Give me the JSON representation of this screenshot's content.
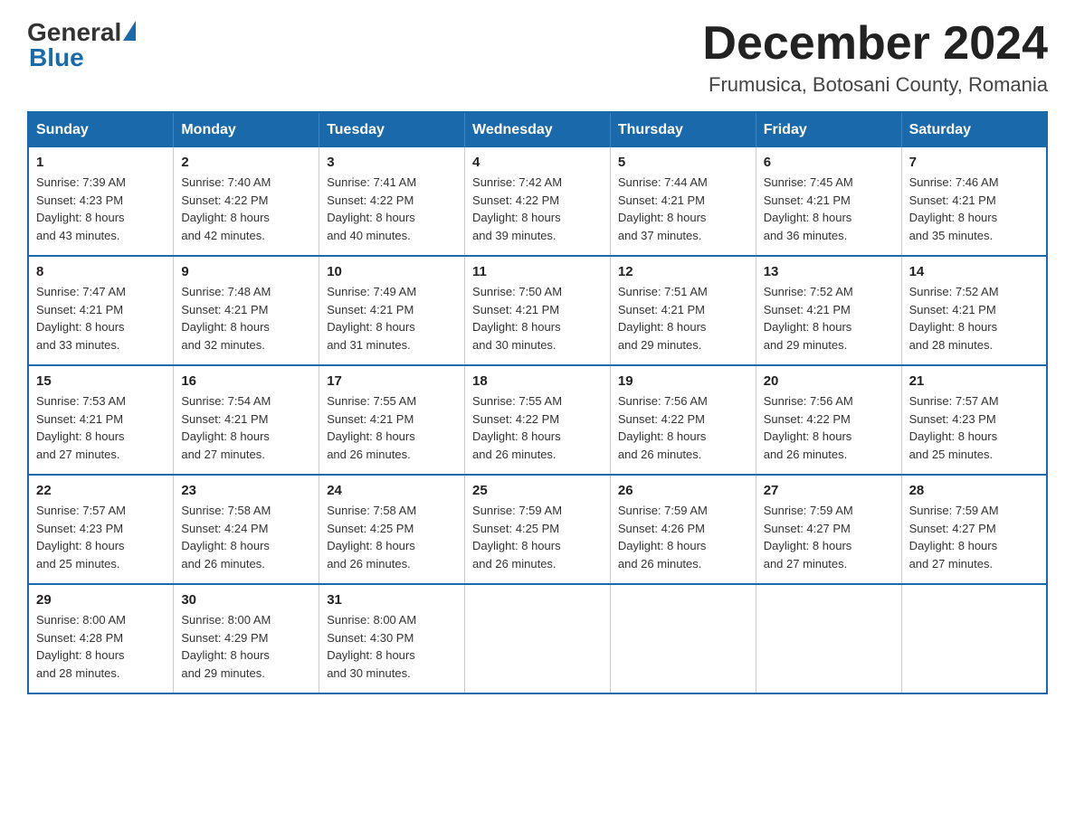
{
  "header": {
    "logo_general": "General",
    "logo_blue": "Blue",
    "month_title": "December 2024",
    "location": "Frumusica, Botosani County, Romania"
  },
  "weekdays": [
    "Sunday",
    "Monday",
    "Tuesday",
    "Wednesday",
    "Thursday",
    "Friday",
    "Saturday"
  ],
  "weeks": [
    [
      {
        "day": "1",
        "sunrise": "7:39 AM",
        "sunset": "4:23 PM",
        "daylight": "8 hours and 43 minutes."
      },
      {
        "day": "2",
        "sunrise": "7:40 AM",
        "sunset": "4:22 PM",
        "daylight": "8 hours and 42 minutes."
      },
      {
        "day": "3",
        "sunrise": "7:41 AM",
        "sunset": "4:22 PM",
        "daylight": "8 hours and 40 minutes."
      },
      {
        "day": "4",
        "sunrise": "7:42 AM",
        "sunset": "4:22 PM",
        "daylight": "8 hours and 39 minutes."
      },
      {
        "day": "5",
        "sunrise": "7:44 AM",
        "sunset": "4:21 PM",
        "daylight": "8 hours and 37 minutes."
      },
      {
        "day": "6",
        "sunrise": "7:45 AM",
        "sunset": "4:21 PM",
        "daylight": "8 hours and 36 minutes."
      },
      {
        "day": "7",
        "sunrise": "7:46 AM",
        "sunset": "4:21 PM",
        "daylight": "8 hours and 35 minutes."
      }
    ],
    [
      {
        "day": "8",
        "sunrise": "7:47 AM",
        "sunset": "4:21 PM",
        "daylight": "8 hours and 33 minutes."
      },
      {
        "day": "9",
        "sunrise": "7:48 AM",
        "sunset": "4:21 PM",
        "daylight": "8 hours and 32 minutes."
      },
      {
        "day": "10",
        "sunrise": "7:49 AM",
        "sunset": "4:21 PM",
        "daylight": "8 hours and 31 minutes."
      },
      {
        "day": "11",
        "sunrise": "7:50 AM",
        "sunset": "4:21 PM",
        "daylight": "8 hours and 30 minutes."
      },
      {
        "day": "12",
        "sunrise": "7:51 AM",
        "sunset": "4:21 PM",
        "daylight": "8 hours and 29 minutes."
      },
      {
        "day": "13",
        "sunrise": "7:52 AM",
        "sunset": "4:21 PM",
        "daylight": "8 hours and 29 minutes."
      },
      {
        "day": "14",
        "sunrise": "7:52 AM",
        "sunset": "4:21 PM",
        "daylight": "8 hours and 28 minutes."
      }
    ],
    [
      {
        "day": "15",
        "sunrise": "7:53 AM",
        "sunset": "4:21 PM",
        "daylight": "8 hours and 27 minutes."
      },
      {
        "day": "16",
        "sunrise": "7:54 AM",
        "sunset": "4:21 PM",
        "daylight": "8 hours and 27 minutes."
      },
      {
        "day": "17",
        "sunrise": "7:55 AM",
        "sunset": "4:21 PM",
        "daylight": "8 hours and 26 minutes."
      },
      {
        "day": "18",
        "sunrise": "7:55 AM",
        "sunset": "4:22 PM",
        "daylight": "8 hours and 26 minutes."
      },
      {
        "day": "19",
        "sunrise": "7:56 AM",
        "sunset": "4:22 PM",
        "daylight": "8 hours and 26 minutes."
      },
      {
        "day": "20",
        "sunrise": "7:56 AM",
        "sunset": "4:22 PM",
        "daylight": "8 hours and 26 minutes."
      },
      {
        "day": "21",
        "sunrise": "7:57 AM",
        "sunset": "4:23 PM",
        "daylight": "8 hours and 25 minutes."
      }
    ],
    [
      {
        "day": "22",
        "sunrise": "7:57 AM",
        "sunset": "4:23 PM",
        "daylight": "8 hours and 25 minutes."
      },
      {
        "day": "23",
        "sunrise": "7:58 AM",
        "sunset": "4:24 PM",
        "daylight": "8 hours and 26 minutes."
      },
      {
        "day": "24",
        "sunrise": "7:58 AM",
        "sunset": "4:25 PM",
        "daylight": "8 hours and 26 minutes."
      },
      {
        "day": "25",
        "sunrise": "7:59 AM",
        "sunset": "4:25 PM",
        "daylight": "8 hours and 26 minutes."
      },
      {
        "day": "26",
        "sunrise": "7:59 AM",
        "sunset": "4:26 PM",
        "daylight": "8 hours and 26 minutes."
      },
      {
        "day": "27",
        "sunrise": "7:59 AM",
        "sunset": "4:27 PM",
        "daylight": "8 hours and 27 minutes."
      },
      {
        "day": "28",
        "sunrise": "7:59 AM",
        "sunset": "4:27 PM",
        "daylight": "8 hours and 27 minutes."
      }
    ],
    [
      {
        "day": "29",
        "sunrise": "8:00 AM",
        "sunset": "4:28 PM",
        "daylight": "8 hours and 28 minutes."
      },
      {
        "day": "30",
        "sunrise": "8:00 AM",
        "sunset": "4:29 PM",
        "daylight": "8 hours and 29 minutes."
      },
      {
        "day": "31",
        "sunrise": "8:00 AM",
        "sunset": "4:30 PM",
        "daylight": "8 hours and 30 minutes."
      },
      null,
      null,
      null,
      null
    ]
  ],
  "labels": {
    "sunrise": "Sunrise:",
    "sunset": "Sunset:",
    "daylight": "Daylight:"
  }
}
